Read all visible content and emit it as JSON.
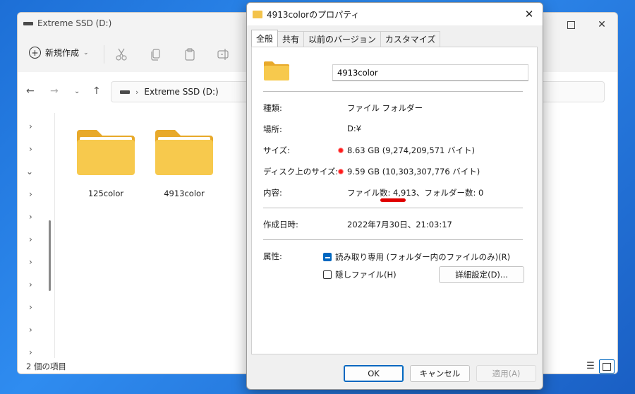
{
  "explorer": {
    "title": "Extreme SSD (D:)",
    "new_label": "新規作成",
    "breadcrumb": "Extreme SSD (D:)",
    "folders": [
      {
        "name": "125color"
      },
      {
        "name": "4913color"
      }
    ],
    "status": "2 個の項目"
  },
  "dialog": {
    "title": "4913colorのプロパティ",
    "tabs": [
      "全般",
      "共有",
      "以前のバージョン",
      "カスタマイズ"
    ],
    "folder_name": "4913color",
    "rows": {
      "type_label": "種類:",
      "type_value": "ファイル フォルダー",
      "location_label": "場所:",
      "location_value": "D:¥",
      "size_label": "サイズ:",
      "size_value": "8.63 GB (9,274,209,571 バイト)",
      "disk_size_label": "ディスク上のサイズ:",
      "disk_size_value": "9.59 GB (10,303,307,776 バイト)",
      "contents_label": "内容:",
      "contents_value": "ファイル数: 4,913、フォルダー数: 0",
      "created_label": "作成日時:",
      "created_value": "2022年7月30日、21:03:17"
    },
    "attributes": {
      "label": "属性:",
      "readonly_label": "読み取り専用 (フォルダー内のファイルのみ)(R)",
      "readonly_checked": true,
      "hidden_label": "隠しファイル(H)",
      "hidden_checked": false,
      "advanced_label": "詳細設定(D)..."
    },
    "buttons": {
      "ok": "OK",
      "cancel": "キャンセル",
      "apply": "適用(A)"
    }
  },
  "colors": {
    "accent": "#0067c0",
    "folder": "#f3c34b",
    "annotation_red": "#e00000"
  }
}
